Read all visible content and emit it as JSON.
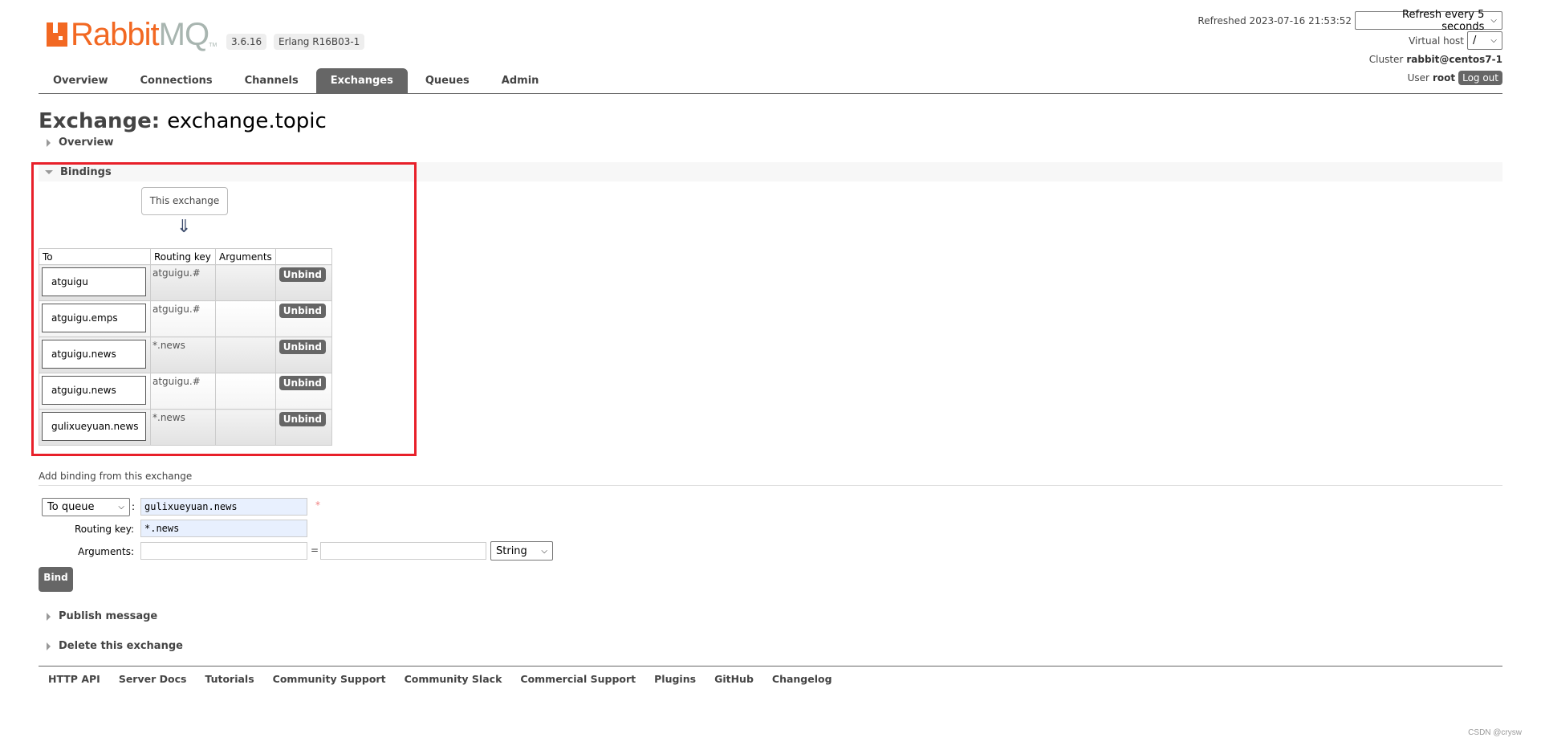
{
  "header": {
    "logo_text_1": "Rabbit",
    "logo_text_2": "MQ",
    "logo_tm": "TM",
    "version": "3.6.16",
    "erlang": "Erlang R16B03-1",
    "refreshed": "Refreshed 2023-07-16 21:53:52",
    "refresh_select": "Refresh every 5 seconds",
    "vhost_label": "Virtual host",
    "vhost_value": "/",
    "cluster_label": "Cluster",
    "cluster_value": "rabbit@centos7-1",
    "user_label": "User",
    "user_value": "root",
    "logout": "Log out",
    "brand_color": "#f26822"
  },
  "tabs": [
    {
      "label": "Overview"
    },
    {
      "label": "Connections"
    },
    {
      "label": "Channels"
    },
    {
      "label": "Exchanges",
      "active": true
    },
    {
      "label": "Queues"
    },
    {
      "label": "Admin"
    }
  ],
  "page": {
    "title_prefix": "Exchange:",
    "title_name": "exchange.topic",
    "overview_section": "Overview",
    "bindings_section": "Bindings",
    "this_exchange": "This exchange",
    "arrow": "⇓"
  },
  "bindings": {
    "headers": [
      "To",
      "Routing key",
      "Arguments",
      ""
    ],
    "unbind_label": "Unbind",
    "rows": [
      {
        "to": "atguigu",
        "routing_key": "atguigu.#",
        "arguments": ""
      },
      {
        "to": "atguigu.emps",
        "routing_key": "atguigu.#",
        "arguments": ""
      },
      {
        "to": "atguigu.news",
        "routing_key": "*.news",
        "arguments": ""
      },
      {
        "to": "atguigu.news",
        "routing_key": "atguigu.#",
        "arguments": ""
      },
      {
        "to": "gulixueyuan.news",
        "routing_key": "*.news",
        "arguments": ""
      }
    ]
  },
  "add_binding": {
    "heading": "Add binding from this exchange",
    "dest_type": "To queue",
    "dest_value": "gulixueyuan.news",
    "required_mark": "*",
    "routing_key_label": "Routing key:",
    "routing_key_value": "*.news",
    "arguments_label": "Arguments:",
    "arg_key": "",
    "arg_value": "",
    "equals": "=",
    "arg_type": "String",
    "bind_button": "Bind"
  },
  "sections": {
    "publish": "Publish message",
    "delete": "Delete this exchange"
  },
  "footer": [
    "HTTP API",
    "Server Docs",
    "Tutorials",
    "Community Support",
    "Community Slack",
    "Commercial Support",
    "Plugins",
    "GitHub",
    "Changelog"
  ],
  "watermark": "CSDN @crysw"
}
